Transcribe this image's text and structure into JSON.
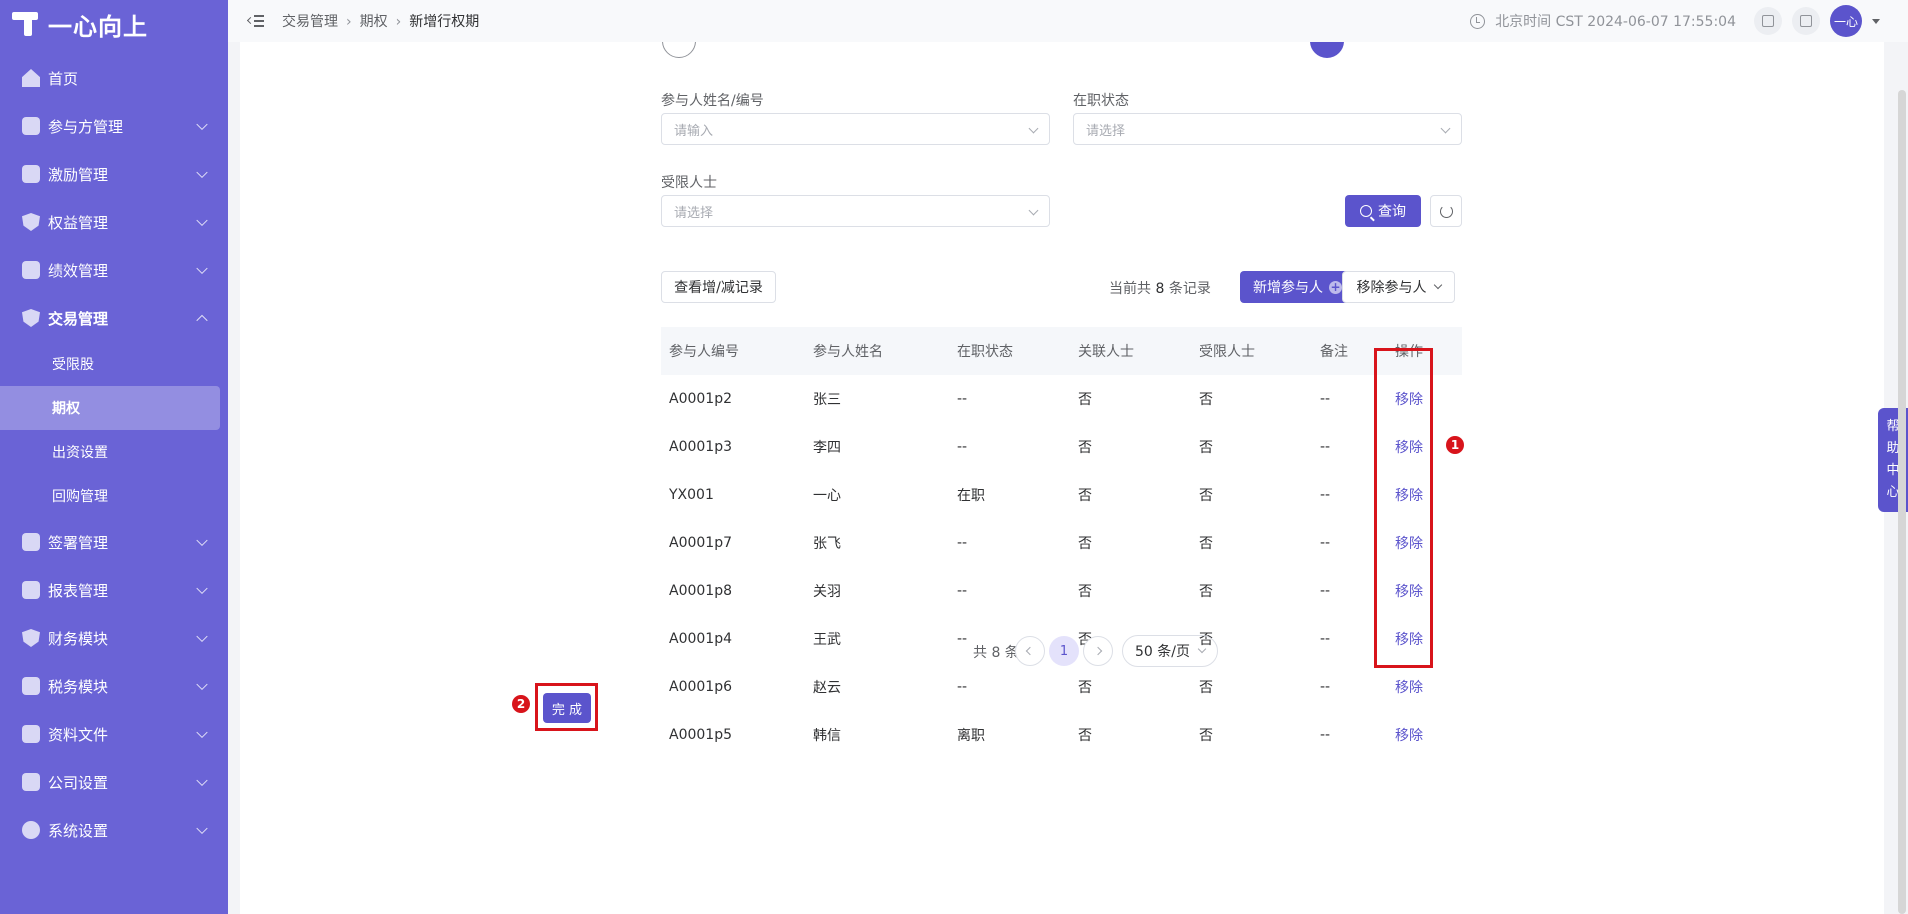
{
  "app": {
    "logo_text": "一心向上"
  },
  "sidebar": {
    "items": [
      {
        "label": "首页",
        "icon": "home-icon"
      },
      {
        "label": "参与方管理",
        "icon": "participant-icon"
      },
      {
        "label": "激励管理",
        "icon": "incentive-icon"
      },
      {
        "label": "权益管理",
        "icon": "equity-icon"
      },
      {
        "label": "绩效管理",
        "icon": "performance-icon"
      },
      {
        "label": "交易管理",
        "icon": "trade-icon"
      },
      {
        "label": "签署管理",
        "icon": "sign-icon"
      },
      {
        "label": "报表管理",
        "icon": "report-icon"
      },
      {
        "label": "财务模块",
        "icon": "finance-icon"
      },
      {
        "label": "税务模块",
        "icon": "tax-icon"
      },
      {
        "label": "资料文件",
        "icon": "file-icon"
      },
      {
        "label": "公司设置",
        "icon": "company-icon"
      },
      {
        "label": "系统设置",
        "icon": "settings-icon"
      }
    ],
    "trade_submenu": [
      "受限股",
      "期权",
      "出资设置",
      "回购管理"
    ]
  },
  "header": {
    "breadcrumb": [
      "交易管理",
      "期权",
      "新增行权期"
    ],
    "time": "北京时间 CST 2024-06-07 17:55:04",
    "avatar_text": "一心"
  },
  "filters": {
    "name_label": "参与人姓名/编号",
    "name_placeholder": "请输入",
    "status_label": "在职状态",
    "status_placeholder": "请选择",
    "restricted_label": "受限人士",
    "restricted_placeholder": "请选择",
    "query_label": "查询"
  },
  "toolbar": {
    "history_label": "查看增/减记录",
    "total_prefix": "当前共",
    "total_count": "8",
    "total_suffix": "条记录",
    "add_label": "新增参与人",
    "remove_label": "移除参与人"
  },
  "table": {
    "headers": [
      "参与人编号",
      "参与人姓名",
      "在职状态",
      "关联人士",
      "受限人士",
      "备注",
      "操作"
    ],
    "rows": [
      [
        "A0001p2",
        "张三",
        "--",
        "否",
        "否",
        "--",
        "移除"
      ],
      [
        "A0001p3",
        "李四",
        "--",
        "否",
        "否",
        "--",
        "移除"
      ],
      [
        "YX001",
        "一心",
        "在职",
        "否",
        "否",
        "--",
        "移除"
      ],
      [
        "A0001p7",
        "张飞",
        "--",
        "否",
        "否",
        "--",
        "移除"
      ],
      [
        "A0001p8",
        "关羽",
        "--",
        "否",
        "否",
        "--",
        "移除"
      ],
      [
        "A0001p4",
        "王武",
        "--",
        "否",
        "否",
        "--",
        "移除"
      ],
      [
        "A0001p6",
        "赵云",
        "--",
        "否",
        "否",
        "--",
        "移除"
      ],
      [
        "A0001p5",
        "韩信",
        "离职",
        "否",
        "否",
        "--",
        "移除"
      ]
    ]
  },
  "pagination": {
    "total": "共 8 条",
    "current": "1",
    "page_size": "50 条/页"
  },
  "footer": {
    "done_label": "完 成"
  },
  "annotations": {
    "badge1": "1",
    "badge2": "2"
  },
  "help": {
    "chars": [
      "帮",
      "助",
      "中",
      "心"
    ]
  },
  "colors": {
    "primary": "#5b54cc",
    "sidebar": "#6a63d6",
    "annotation": "#d8141b"
  }
}
